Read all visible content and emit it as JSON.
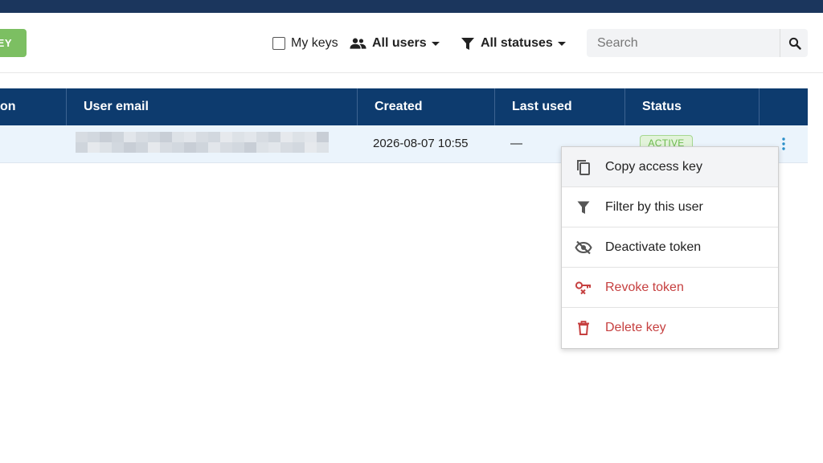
{
  "toolbar": {
    "add_button_label": "EY",
    "my_keys_label": "My keys",
    "users_filter_label": "All users",
    "status_filter_label": "All statuses",
    "search_placeholder": "Search",
    "search_value": ""
  },
  "table": {
    "columns": [
      "on",
      "User email",
      "Created",
      "Last used",
      "Status"
    ],
    "rows": [
      {
        "user_email": "",
        "created": "2026-08-07 10:55",
        "last_used": "—",
        "status": "ACTIVE"
      }
    ]
  },
  "context_menu": {
    "items": [
      {
        "label": "Copy access key",
        "icon": "copy-icon",
        "danger": false
      },
      {
        "label": "Filter by this user",
        "icon": "filter-icon",
        "danger": false
      },
      {
        "label": "Deactivate token",
        "icon": "eye-off-icon",
        "danger": false
      },
      {
        "label": "Revoke token",
        "icon": "key-remove-icon",
        "danger": true
      },
      {
        "label": "Delete key",
        "icon": "trash-icon",
        "danger": true
      }
    ]
  },
  "colors": {
    "header_bar": "#1b365d",
    "table_header": "#0d3b6e",
    "add_button": "#7cbf62",
    "active_badge": "#6dbb4f",
    "danger": "#c64040",
    "kebab": "#2a8fc9"
  }
}
